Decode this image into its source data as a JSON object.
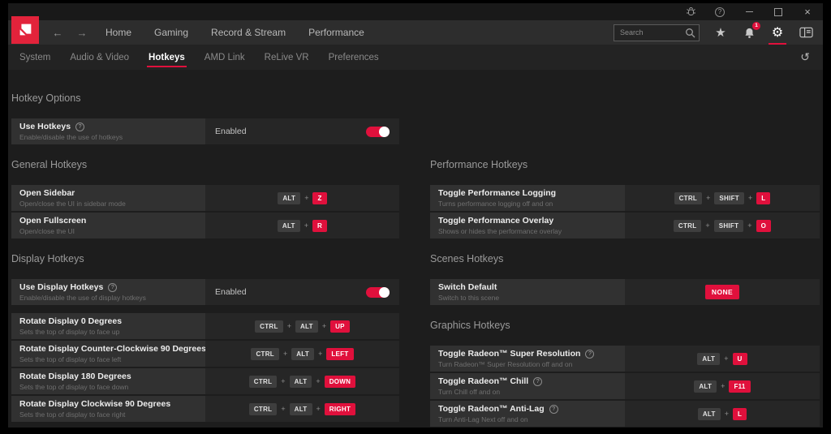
{
  "colors": {
    "accent_red": "#e0103c",
    "logo_red": "#e2233b"
  },
  "titlebar": {
    "icons": [
      "bug-report",
      "help",
      "minimize",
      "maximize",
      "close"
    ]
  },
  "navbar": {
    "items": [
      {
        "label": "Home"
      },
      {
        "label": "Gaming"
      },
      {
        "label": "Record & Stream"
      },
      {
        "label": "Performance"
      }
    ],
    "search": {
      "placeholder": "Search"
    },
    "notification_count": "1"
  },
  "tabbar": {
    "tabs": [
      {
        "label": "System",
        "active": false
      },
      {
        "label": "Audio & Video",
        "active": false
      },
      {
        "label": "Hotkeys",
        "active": true
      },
      {
        "label": "AMD Link",
        "active": false
      },
      {
        "label": "ReLive VR",
        "active": false
      },
      {
        "label": "Preferences",
        "active": false
      }
    ]
  },
  "content": {
    "key_separator": "+",
    "left_sections": [
      {
        "title": "Hotkey Options",
        "rows": [
          {
            "title": "Use Hotkeys",
            "subtitle": "Enable/disable the use of hotkeys",
            "help": true,
            "control": {
              "type": "toggle",
              "label": "Enabled",
              "on": true
            }
          }
        ]
      },
      {
        "title": "General Hotkeys",
        "rows": [
          {
            "title": "Open Sidebar",
            "subtitle": "Open/close the UI in sidebar mode",
            "control": {
              "type": "keys",
              "keys": [
                "ALT",
                "Z"
              ]
            }
          },
          {
            "title": "Open Fullscreen",
            "subtitle": "Open/close the UI",
            "control": {
              "type": "keys",
              "keys": [
                "ALT",
                "R"
              ]
            }
          }
        ]
      },
      {
        "title": "Display Hotkeys",
        "rows": [
          {
            "title": "Use Display Hotkeys",
            "subtitle": "Enable/disable the use of display hotkeys",
            "help": true,
            "gap_after": true,
            "control": {
              "type": "toggle",
              "label": "Enabled",
              "on": true
            }
          },
          {
            "title": "Rotate Display 0 Degrees",
            "subtitle": "Sets the top of display to face up",
            "control": {
              "type": "keys",
              "keys": [
                "CTRL",
                "ALT",
                "UP"
              ]
            }
          },
          {
            "title": "Rotate Display Counter-Clockwise 90 Degrees",
            "subtitle": "Sets the top of display to face left",
            "control": {
              "type": "keys",
              "keys": [
                "CTRL",
                "ALT",
                "LEFT"
              ]
            }
          },
          {
            "title": "Rotate Display 180 Degrees",
            "subtitle": "Sets the top of display to face down",
            "control": {
              "type": "keys",
              "keys": [
                "CTRL",
                "ALT",
                "DOWN"
              ]
            }
          },
          {
            "title": "Rotate Display Clockwise 90 Degrees",
            "subtitle": "Sets the top of display to face right",
            "control": {
              "type": "keys",
              "keys": [
                "CTRL",
                "ALT",
                "RIGHT"
              ]
            }
          }
        ]
      }
    ],
    "right_sections": [
      {
        "title": "Performance Hotkeys",
        "rows": [
          {
            "title": "Toggle Performance Logging",
            "subtitle": "Turns performance logging off and on",
            "control": {
              "type": "keys",
              "keys": [
                "CTRL",
                "SHIFT",
                "L"
              ]
            }
          },
          {
            "title": "Toggle Performance Overlay",
            "subtitle": "Shows or hides the performance overlay",
            "control": {
              "type": "keys",
              "keys": [
                "CTRL",
                "SHIFT",
                "O"
              ]
            }
          }
        ]
      },
      {
        "title": "Scenes Hotkeys",
        "rows": [
          {
            "title": "Switch Default",
            "subtitle": "Switch to this scene",
            "control": {
              "type": "badge",
              "label": "NONE"
            }
          }
        ]
      },
      {
        "title": "Graphics Hotkeys",
        "rows": [
          {
            "title": "Toggle Radeon™ Super Resolution",
            "subtitle": "Turn Radeon™ Super Resolution off and on",
            "help": true,
            "control": {
              "type": "keys",
              "keys": [
                "ALT",
                "U"
              ]
            }
          },
          {
            "title": "Toggle Radeon™ Chill",
            "subtitle": "Turn Chill off and on",
            "help": true,
            "control": {
              "type": "keys",
              "keys": [
                "ALT",
                "F11"
              ]
            }
          },
          {
            "title": "Toggle Radeon™ Anti-Lag",
            "subtitle": "Turn Anti-Lag Next off and on",
            "help": true,
            "control": {
              "type": "keys",
              "keys": [
                "ALT",
                "L"
              ]
            }
          }
        ]
      }
    ]
  }
}
